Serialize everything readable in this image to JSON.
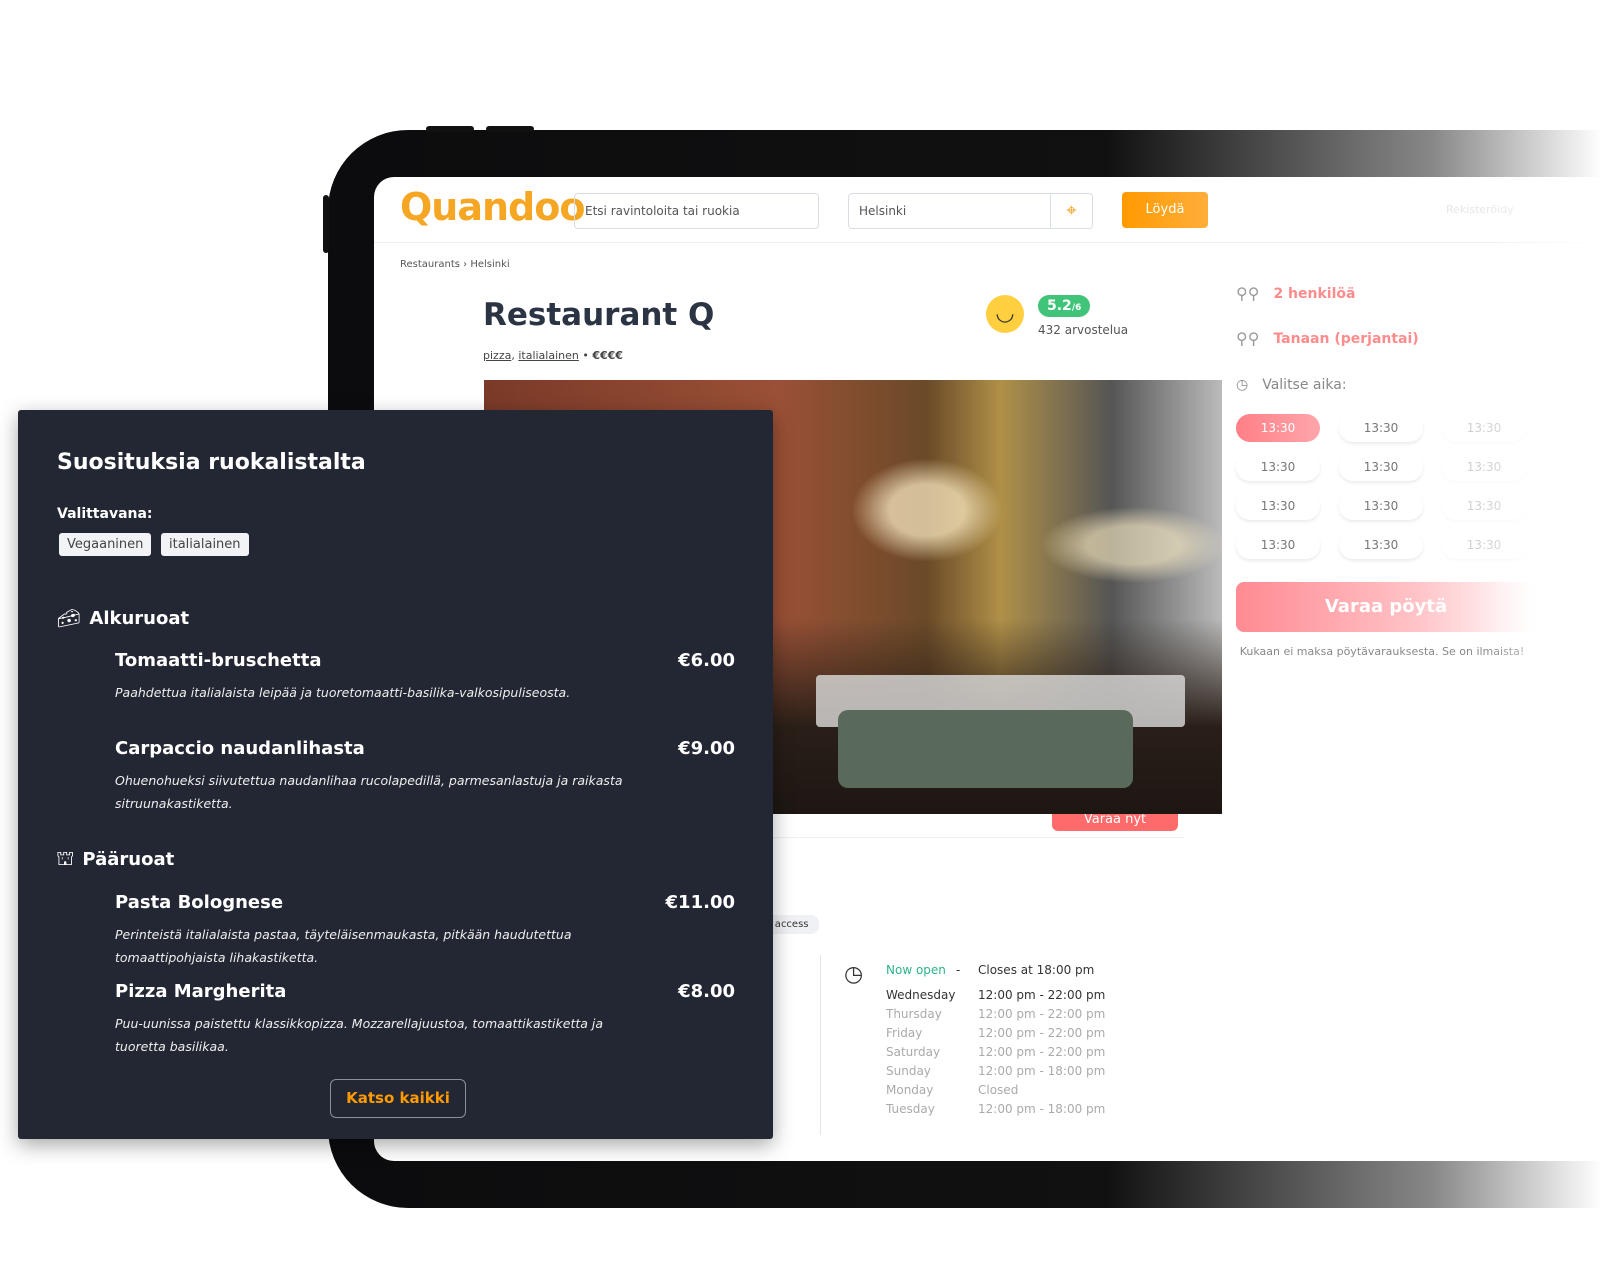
{
  "header": {
    "logo": "Quandoo",
    "search_placeholder": "Etsi ravintoloita tai ruokia",
    "location": "Helsinki",
    "find_label": "Löydä",
    "register_label": "Rekisteröidy"
  },
  "breadcrumb": [
    "Restaurants",
    "Helsinki"
  ],
  "restaurant": {
    "name": "Restaurant Q",
    "cuisines": [
      "pizza",
      "italialainen"
    ],
    "price": "€€€€",
    "rating": "5.2",
    "rating_scale": "/6",
    "reviews": "432 arvostelua",
    "book_now_label": "Varaa nyt",
    "feature_chip": "lchair access"
  },
  "hours": {
    "status": "Now open",
    "separator": "-",
    "closes": "Closes at 18:00 pm",
    "days": [
      {
        "day": "Wednesday",
        "time": "12:00 pm - 22:00 pm"
      },
      {
        "day": "Thursday",
        "time": "12:00 pm - 22:00 pm"
      },
      {
        "day": "Friday",
        "time": "12:00 pm - 22:00 pm"
      },
      {
        "day": "Saturday",
        "time": "12:00 pm - 22:00 pm"
      },
      {
        "day": "Sunday",
        "time": "12:00 pm - 18:00 pm"
      },
      {
        "day": "Monday",
        "time": "Closed"
      },
      {
        "day": "Tuesday",
        "time": "12:00 pm - 18:00 pm"
      }
    ]
  },
  "booking": {
    "guests": "2 henkilöä",
    "date": "Tanaan (perjantai)",
    "time_label": "Valitse aika:",
    "slots": [
      "13:30",
      "13:30",
      "13:30",
      "13:30",
      "13:30",
      "13:30",
      "13:30",
      "13:30",
      "13:30",
      "13:30",
      "13:30",
      "13:30"
    ],
    "selected_slot": 0,
    "book_label": "Varaa pöytä",
    "note": "Kukaan ei maksa pöytävarauksesta. Se on ilmaista!"
  },
  "menu": {
    "title": "Suosituksia ruokalistalta",
    "filter_label": "Valittavana:",
    "tags": [
      "Vegaaninen",
      "italialainen"
    ],
    "categories": [
      {
        "name": "Alkuruoat",
        "icon": "cheese-icon",
        "items": [
          {
            "name": "Tomaatti-bruschetta",
            "price": "€6.00",
            "desc": "Paahdettua italialaista leipää ja tuoretomaatti-basilika-valkosipuliseosta."
          },
          {
            "name": "Carpaccio naudanlihasta",
            "price": "€9.00",
            "desc": "Ohuenohueksi siivutettua naudanlihaa rucolapedillä, parmesanlastuja ja raikasta sitruunakastiketta."
          }
        ]
      },
      {
        "name": "Pääruoat",
        "icon": "cloche-icon",
        "items": [
          {
            "name": "Pasta Bolognese",
            "price": "€11.00",
            "desc": "Perinteistä italialaista pastaa, täyteläisenmaukasta, pitkään haudutettua tomaattipohjaista lihakastiketta."
          },
          {
            "name": "Pizza Margherita",
            "price": "€8.00",
            "desc": "Puu-uunissa paistettu klassikkopizza. Mozzarellajuustoa, tomaattikastiketta ja tuoretta basilikaa."
          }
        ]
      }
    ],
    "see_all_label": "Katso kaikki"
  },
  "colors": {
    "brand": "#f5a623",
    "accent": "#ff7f86",
    "panel": "#232733",
    "open": "#2bb38a"
  }
}
